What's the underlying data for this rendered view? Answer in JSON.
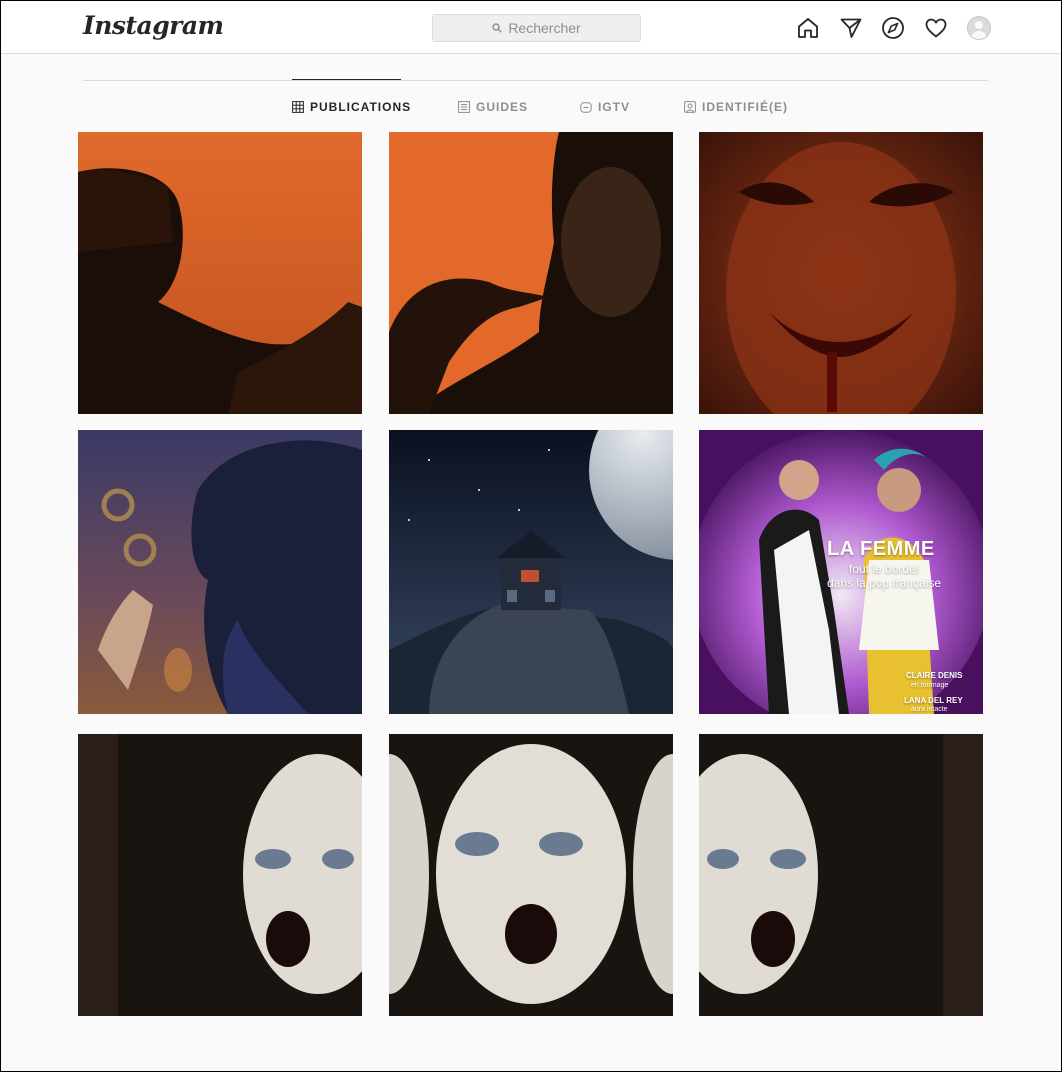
{
  "header": {
    "logo": "Instagram",
    "search_placeholder": "Rechercher"
  },
  "tabs": [
    {
      "label": "PUBLICATIONS",
      "icon": "grid-icon",
      "active": true
    },
    {
      "label": "GUIDES",
      "icon": "guides-icon",
      "active": false
    },
    {
      "label": "IGTV",
      "icon": "igtv-icon",
      "active": false
    },
    {
      "label": "IDENTIFIÉ(E)",
      "icon": "tagged-icon",
      "active": false
    }
  ],
  "posts": [
    {
      "subject": "silhouette-orange"
    },
    {
      "subject": "silhouette-hand-orange"
    },
    {
      "subject": "vampire-face"
    },
    {
      "subject": "hooded-figure-tambourine"
    },
    {
      "subject": "haunted-house-moon"
    },
    {
      "subject": "magazine-cover",
      "cover": {
        "headline": "LA FEMME",
        "subheadline_1": "fout le bordel",
        "subheadline_2": "dans la pop française",
        "story_1_title": "CLAIRE DENIS",
        "story_1_sub": "en tournage",
        "story_2_title": "LANA DEL REY",
        "story_2_sub": "aura intacte"
      }
    },
    {
      "subject": "pale-face-left"
    },
    {
      "subject": "pale-face-center"
    },
    {
      "subject": "pale-face-right"
    }
  ],
  "colors": {
    "accent_orange": "#e56b2a",
    "text": "#262626",
    "muted": "#8e8e8e",
    "border": "#dbdbdb"
  }
}
